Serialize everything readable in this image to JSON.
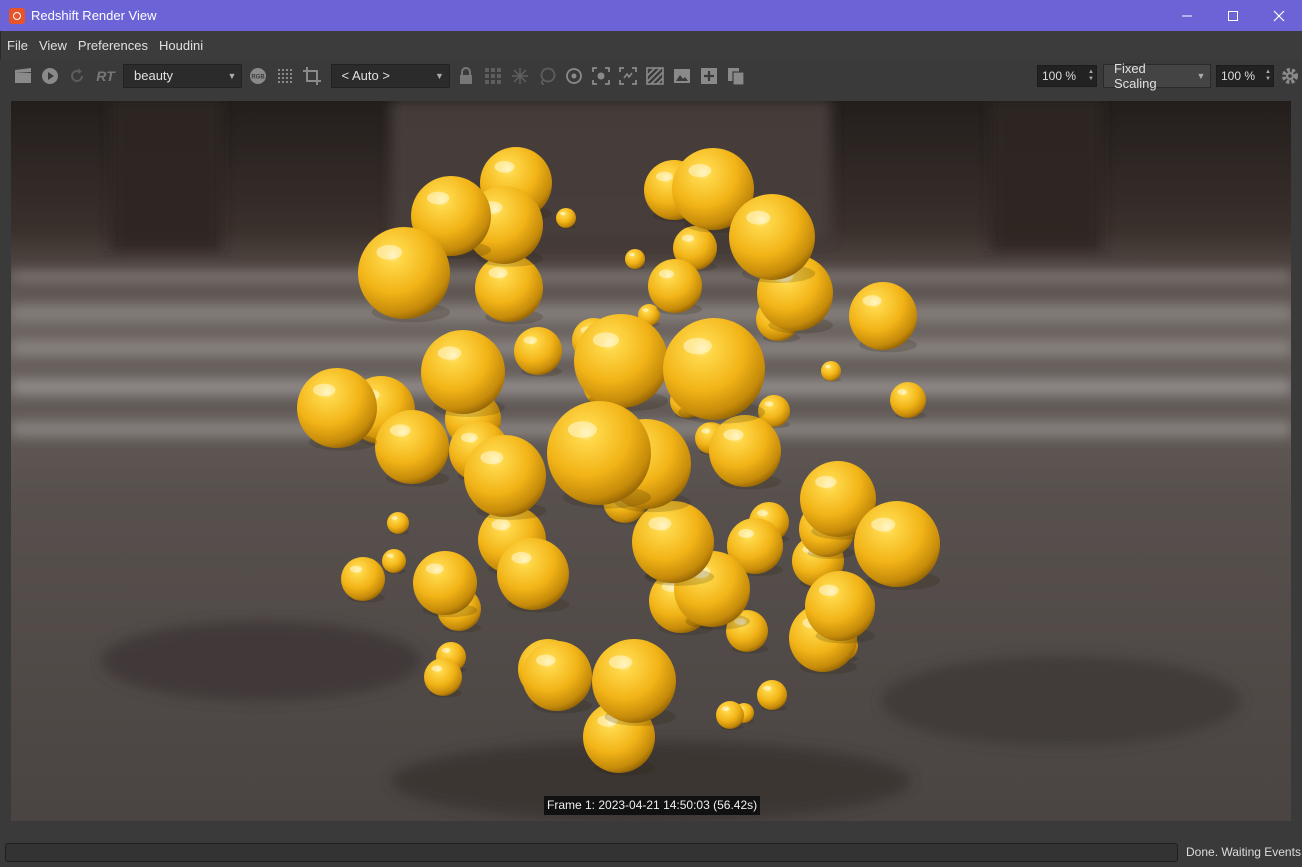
{
  "window": {
    "title": "Redshift Render View",
    "controls": [
      "minimize",
      "maximize",
      "close"
    ]
  },
  "menu": {
    "items": [
      "File",
      "View",
      "Preferences",
      "Houdini"
    ]
  },
  "toolbar": {
    "aov_select": "beauty",
    "camera_select": "< Auto >",
    "rgb_label": "RGB",
    "rt_label": "RT",
    "zoom_value": "100 %",
    "scaling_mode": "Fixed Scaling",
    "scale_value": "100 %",
    "icons": [
      "clapperboard-icon",
      "play-icon",
      "refresh-icon",
      "rt-icon",
      "rgb-icon",
      "grid-icon",
      "crop-icon",
      "lock-icon",
      "tiles-icon",
      "snowflake-icon",
      "lasso-icon",
      "target-icon",
      "focus-icon",
      "region-icon",
      "stripes-icon",
      "image-icon",
      "add-snapshot-icon",
      "copy-icon",
      "gear-icon"
    ]
  },
  "render": {
    "frame_info": "Frame  1:  2023-04-21  14:50:03  (56.42s)"
  },
  "status": {
    "text": "Done. Waiting Events",
    "progress": 0
  },
  "colors": {
    "titlebar": "#6b63d6",
    "sphere": "#f2b417",
    "background": "#3a3a3a"
  }
}
